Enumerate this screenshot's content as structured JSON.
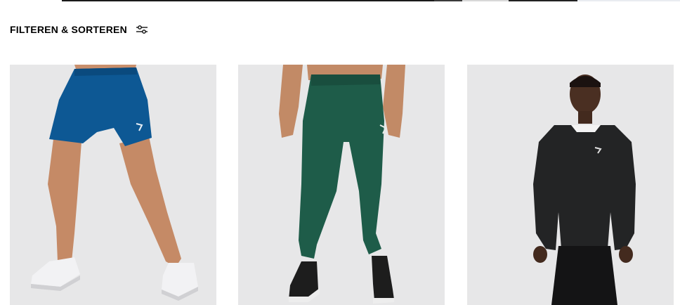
{
  "top_strip": {
    "segments": [
      {
        "color": "#ffffff"
      },
      {
        "color": "#1a1a1a"
      },
      {
        "color": "#3a3a3a"
      },
      {
        "color": "#d8d8d8"
      },
      {
        "color": "#222222"
      },
      {
        "color": "#e9ecf1"
      }
    ]
  },
  "filter_bar": {
    "label": "FILTEREN & SORTEREN",
    "icon": "sliders-icon"
  },
  "products": [
    {
      "image": "blue-training-shorts",
      "color": "#0d5894"
    },
    {
      "image": "green-joggers",
      "color": "#1e5c49"
    },
    {
      "image": "black-crew-sweatshirt",
      "color": "#232425"
    }
  ]
}
